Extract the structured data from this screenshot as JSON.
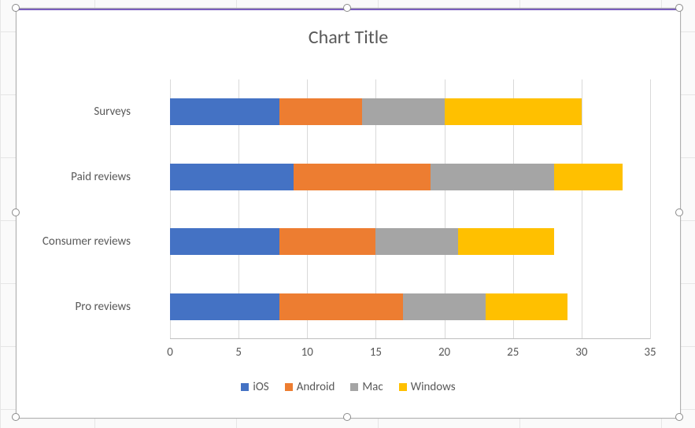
{
  "chart_data": {
    "type": "bar",
    "orientation": "horizontal",
    "stacked": true,
    "title": "Chart Title",
    "xlabel": "",
    "ylabel": "",
    "xlim": [
      0,
      35
    ],
    "xticks": [
      0,
      5,
      10,
      15,
      20,
      25,
      30,
      35
    ],
    "categories": [
      "Pro reviews",
      "Consumer reviews",
      "Paid reviews",
      "Surveys"
    ],
    "series": [
      {
        "name": "iOS",
        "values": [
          8,
          8,
          9,
          8
        ]
      },
      {
        "name": "Android",
        "values": [
          9,
          7,
          10,
          6
        ]
      },
      {
        "name": "Mac",
        "values": [
          6,
          6,
          9,
          6
        ]
      },
      {
        "name": "Windows",
        "values": [
          6,
          7,
          5,
          10
        ]
      }
    ],
    "colors": [
      "#4472c4",
      "#ed7d31",
      "#a5a5a5",
      "#ffc000"
    ],
    "legend_position": "bottom",
    "grid": true
  },
  "ui": {
    "selected": true
  }
}
